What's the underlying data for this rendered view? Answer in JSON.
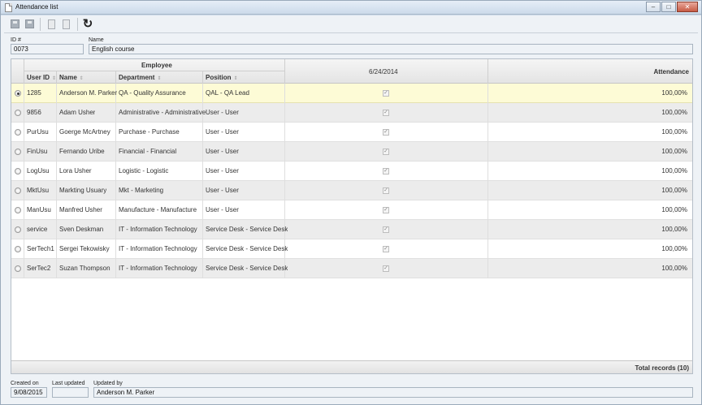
{
  "window": {
    "title": "Attendance list",
    "controls": [
      "minimize-icon",
      "maximize-icon",
      "close-icon"
    ]
  },
  "toolbar": {
    "icons": [
      "save-icon",
      "save-new-icon",
      "copy-icon",
      "paste-icon",
      "refresh-icon"
    ]
  },
  "form": {
    "id_label": "ID #",
    "id_value": "0073",
    "name_label": "Name",
    "name_value": "English course"
  },
  "grid": {
    "group_header": "Employee",
    "columns": {
      "user_id": "User ID",
      "name": "Name",
      "department": "Department",
      "position": "Position",
      "date": "6/24/2014",
      "attendance": "Attendance"
    },
    "rows": [
      {
        "user_id": "1285",
        "name": "Anderson M. Parker",
        "department": "QA - Quality Assurance",
        "position": "QAL - QA Lead",
        "present": true,
        "attendance": "100,00%",
        "selected": true
      },
      {
        "user_id": "9856",
        "name": "Adam Usher",
        "department": "Administrative - Administrative",
        "position": "User - User",
        "present": true,
        "attendance": "100,00%",
        "selected": false
      },
      {
        "user_id": "PurUsu",
        "name": "Goerge McArtney",
        "department": "Purchase - Purchase",
        "position": "User - User",
        "present": true,
        "attendance": "100,00%",
        "selected": false
      },
      {
        "user_id": "FinUsu",
        "name": "Fernando Uribe",
        "department": "Financial - Financial",
        "position": "User - User",
        "present": true,
        "attendance": "100,00%",
        "selected": false
      },
      {
        "user_id": "LogUsu",
        "name": "Lora Usher",
        "department": "Logistic - Logistic",
        "position": "User - User",
        "present": true,
        "attendance": "100,00%",
        "selected": false
      },
      {
        "user_id": "MktUsu",
        "name": "Markting Usuary",
        "department": "Mkt - Marketing",
        "position": "User - User",
        "present": true,
        "attendance": "100,00%",
        "selected": false
      },
      {
        "user_id": "ManUsu",
        "name": "Manfred Usher",
        "department": "Manufacture - Manufacture",
        "position": "User - User",
        "present": true,
        "attendance": "100,00%",
        "selected": false
      },
      {
        "user_id": "service",
        "name": "Sven Deskman",
        "department": "IT - Information Technology",
        "position": "Service Desk - Service Desk",
        "present": true,
        "attendance": "100,00%",
        "selected": false
      },
      {
        "user_id": "SerTech1",
        "name": "Sergei Tekowisky",
        "department": "IT - Information Technology",
        "position": "Service Desk - Service Desk",
        "present": true,
        "attendance": "100,00%",
        "selected": false
      },
      {
        "user_id": "SerTec2",
        "name": "Suzan Thompson",
        "department": "IT - Information Technology",
        "position": "Service Desk - Service Desk",
        "present": true,
        "attendance": "100,00%",
        "selected": false
      }
    ],
    "total_records": "Total records (10)"
  },
  "footer": {
    "created_label": "Created on",
    "created_value": "9/08/2015",
    "updated_label": "Last updated",
    "updated_value": "",
    "updated_by_label": "Updated by",
    "updated_by_value": "Anderson M. Parker"
  }
}
